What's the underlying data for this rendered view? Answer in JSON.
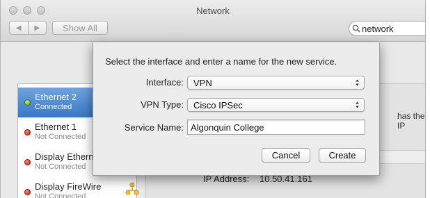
{
  "window": {
    "title": "Network"
  },
  "toolbar": {
    "back_glyph": "◀",
    "forward_glyph": "▶",
    "show_all_label": "Show All",
    "search_value": "network"
  },
  "sidebar": {
    "items": [
      {
        "name": "Ethernet 2",
        "status": "Connected",
        "indicator": "green",
        "selected": true
      },
      {
        "name": "Ethernet 1",
        "status": "Not Connected",
        "indicator": "red"
      },
      {
        "name": "Display Ethernet",
        "status": "Not Connected",
        "indicator": "red"
      },
      {
        "name": "Display FireWire",
        "status": "Not Connected",
        "indicator": "red"
      }
    ]
  },
  "detail": {
    "partial_text_right": "has the IP",
    "ip_label": "IP Address:",
    "ip_value": "10.50.41.161"
  },
  "sheet": {
    "message": "Select the interface and enter a name for the new service.",
    "interface_label": "Interface:",
    "interface_value": "VPN",
    "vpn_type_label": "VPN Type:",
    "vpn_type_value": "Cisco IPSec",
    "service_name_label": "Service Name:",
    "service_name_value": "Algonquin College",
    "cancel_label": "Cancel",
    "create_label": "Create"
  },
  "colors": {
    "selection": "#3a76c4",
    "status_connected": "#59a314",
    "status_disconnected": "#d11a0a"
  }
}
